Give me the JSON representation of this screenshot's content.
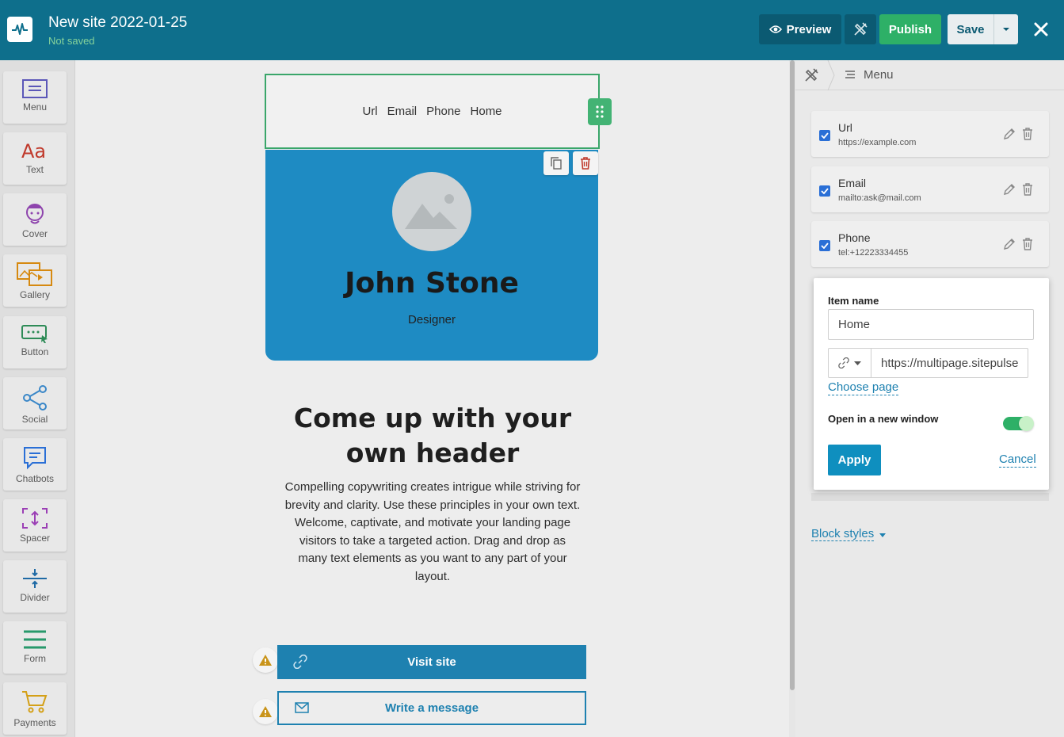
{
  "header": {
    "site_title": "New site 2022-01-25",
    "status": "Not saved",
    "preview_label": "Preview",
    "publish_label": "Publish",
    "save_label": "Save"
  },
  "toolbar": {
    "items": [
      {
        "label": "Menu",
        "icon": "menu-icon"
      },
      {
        "label": "Text",
        "icon": "text-icon"
      },
      {
        "label": "Cover",
        "icon": "cover-icon"
      },
      {
        "label": "Gallery",
        "icon": "gallery-icon"
      },
      {
        "label": "Button",
        "icon": "button-icon"
      },
      {
        "label": "Social",
        "icon": "social-icon"
      },
      {
        "label": "Chatbots",
        "icon": "chatbots-icon"
      },
      {
        "label": "Spacer",
        "icon": "spacer-icon"
      },
      {
        "label": "Divider",
        "icon": "divider-icon"
      },
      {
        "label": "Form",
        "icon": "form-icon"
      },
      {
        "label": "Payments",
        "icon": "cart-icon"
      }
    ]
  },
  "canvas": {
    "menu_links": [
      "Url",
      "Email",
      "Phone",
      "Home"
    ],
    "cover": {
      "name": "John Stone",
      "role": "Designer"
    },
    "heading": "Come up with your own header",
    "body": "Compelling copywriting creates intrigue while striving for brevity and clarity. Use these principles in your own text. Welcome, captivate, and motivate your landing page visitors to take a targeted action. Drag and drop as many text elements as you want to any part of your layout.",
    "visit_button": "Visit site",
    "message_button": "Write a message"
  },
  "panel": {
    "title": "Menu",
    "items": [
      {
        "name": "Url",
        "url": "https://example.com"
      },
      {
        "name": "Email",
        "url": "mailto:ask@mail.com"
      },
      {
        "name": "Phone",
        "url": "tel:+12223334455"
      }
    ],
    "block_styles": "Block styles"
  },
  "modal": {
    "item_name_label": "Item name",
    "item_name_value": "Home",
    "url_value": "https://multipage.sitepulse",
    "choose_page": "Choose page",
    "open_new_window_label": "Open in a new window",
    "open_new_window": true,
    "apply_label": "Apply",
    "cancel_label": "Cancel"
  },
  "colors": {
    "topbar": "#0e6f8c",
    "publish": "#2eb067",
    "accent": "#1e81b0",
    "cover_bg": "#1e8bc3",
    "selection": "#3aa66a"
  }
}
